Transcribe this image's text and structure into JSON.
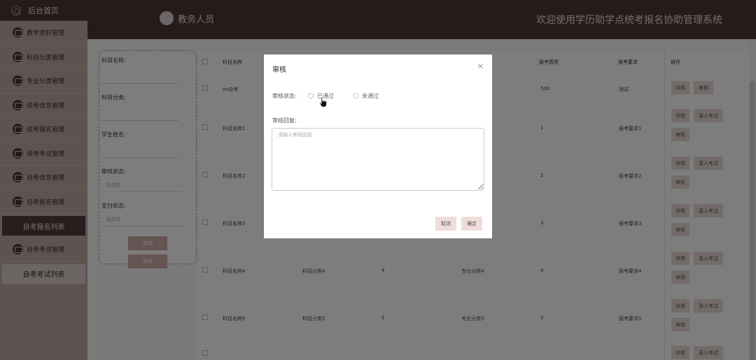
{
  "sidebar": {
    "home": "后台首页",
    "items": [
      {
        "label": "教学资料管理"
      },
      {
        "label": "科目分类管理"
      },
      {
        "label": "专业分类管理"
      },
      {
        "label": "成考信息管理"
      },
      {
        "label": "成考报名管理"
      },
      {
        "label": "成考考试管理"
      },
      {
        "label": "自考信息管理"
      },
      {
        "label": "自考报名管理"
      }
    ],
    "active_sub": "自考报名列表",
    "after_item": "自考考试管理",
    "plain_sub": "自考考试列表"
  },
  "header": {
    "role": "教务人员",
    "title": "欢迎使用学历助学点统考报名协助管理系统"
  },
  "search": {
    "subject_name_label": "科目名称:",
    "subject_category_label": "科目分类:",
    "student_name_label": "学生姓名:",
    "review_status_label": "审核状态:",
    "review_status_placeholder": "请选择",
    "pay_status_label": "支付状态:",
    "pay_status_placeholder": "请选择",
    "query_button": "查询",
    "export_button": "导出"
  },
  "table": {
    "headers": {
      "subject_name": "科目名称",
      "fee": "报考费用",
      "requirement": "报考要求",
      "ops": "操作"
    },
    "rows": [
      {
        "name": "xx自考",
        "category": "",
        "num": "",
        "major": "",
        "fee": "500",
        "req": "测试",
        "ops": [
          "详情",
          "审核"
        ]
      },
      {
        "name": "科目名称1",
        "category": "",
        "num": "",
        "major": "",
        "fee": "1",
        "req": "报考要求1",
        "ops": [
          "详情",
          "录入考试",
          "审核"
        ]
      },
      {
        "name": "科目名称2",
        "category": "",
        "num": "",
        "major": "",
        "fee": "2",
        "req": "报考要求2",
        "ops": [
          "详情",
          "录入考试",
          "审核"
        ]
      },
      {
        "name": "科目名称3",
        "category": "",
        "num": "",
        "major": "",
        "fee": "3",
        "req": "报考要求3",
        "ops": [
          "详情",
          "录入考试",
          "审核"
        ]
      },
      {
        "name": "科目名称4",
        "category": "科目分类4",
        "num": "4",
        "major": "专业分类4",
        "fee": "4",
        "req": "报考要求4",
        "ops": [
          "详情",
          "录入考试",
          "审核"
        ]
      },
      {
        "name": "科目名称5",
        "category": "科目分类5",
        "num": "5",
        "major": "专业分类5",
        "fee": "5",
        "req": "报考要求5",
        "ops": [
          "详情",
          "录入考试",
          "审核"
        ]
      },
      {
        "name": "",
        "category": "",
        "num": "",
        "major": "",
        "fee": "",
        "req": "",
        "ops": [
          "详情",
          "录入考试"
        ]
      }
    ]
  },
  "modal": {
    "title": "审核",
    "close": "×",
    "status_label": "审核状态:",
    "option_pass": "已通过",
    "option_fail": "未通过",
    "reply_label": "审核回复:",
    "reply_placeholder": "请输入审核回复",
    "cancel": "取消",
    "confirm": "确定"
  }
}
